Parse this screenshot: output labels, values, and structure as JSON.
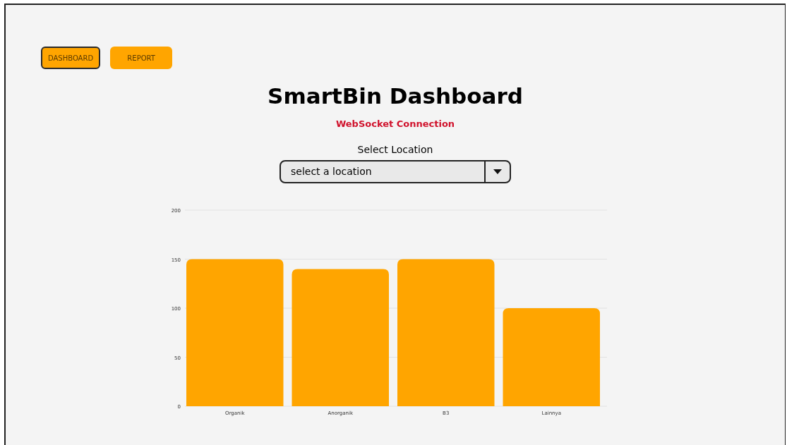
{
  "nav": [
    {
      "label": "DASHBOARD",
      "selected": true
    },
    {
      "label": "REPORT",
      "selected": false
    }
  ],
  "title": "SmartBin Dashboard",
  "connection_status": "WebSocket Connection",
  "location_select": {
    "label": "Select Location",
    "value": "select a location"
  },
  "chart_data": {
    "type": "bar",
    "categories": [
      "Organik",
      "Anorganik",
      "B3",
      "Lainnya"
    ],
    "series": [
      {
        "color": "#ffa500",
        "values": [
          150,
          140,
          150,
          100
        ]
      }
    ],
    "grid": true,
    "ylim": [
      0,
      200
    ],
    "yticks": [
      0,
      50,
      100,
      150,
      200
    ]
  }
}
